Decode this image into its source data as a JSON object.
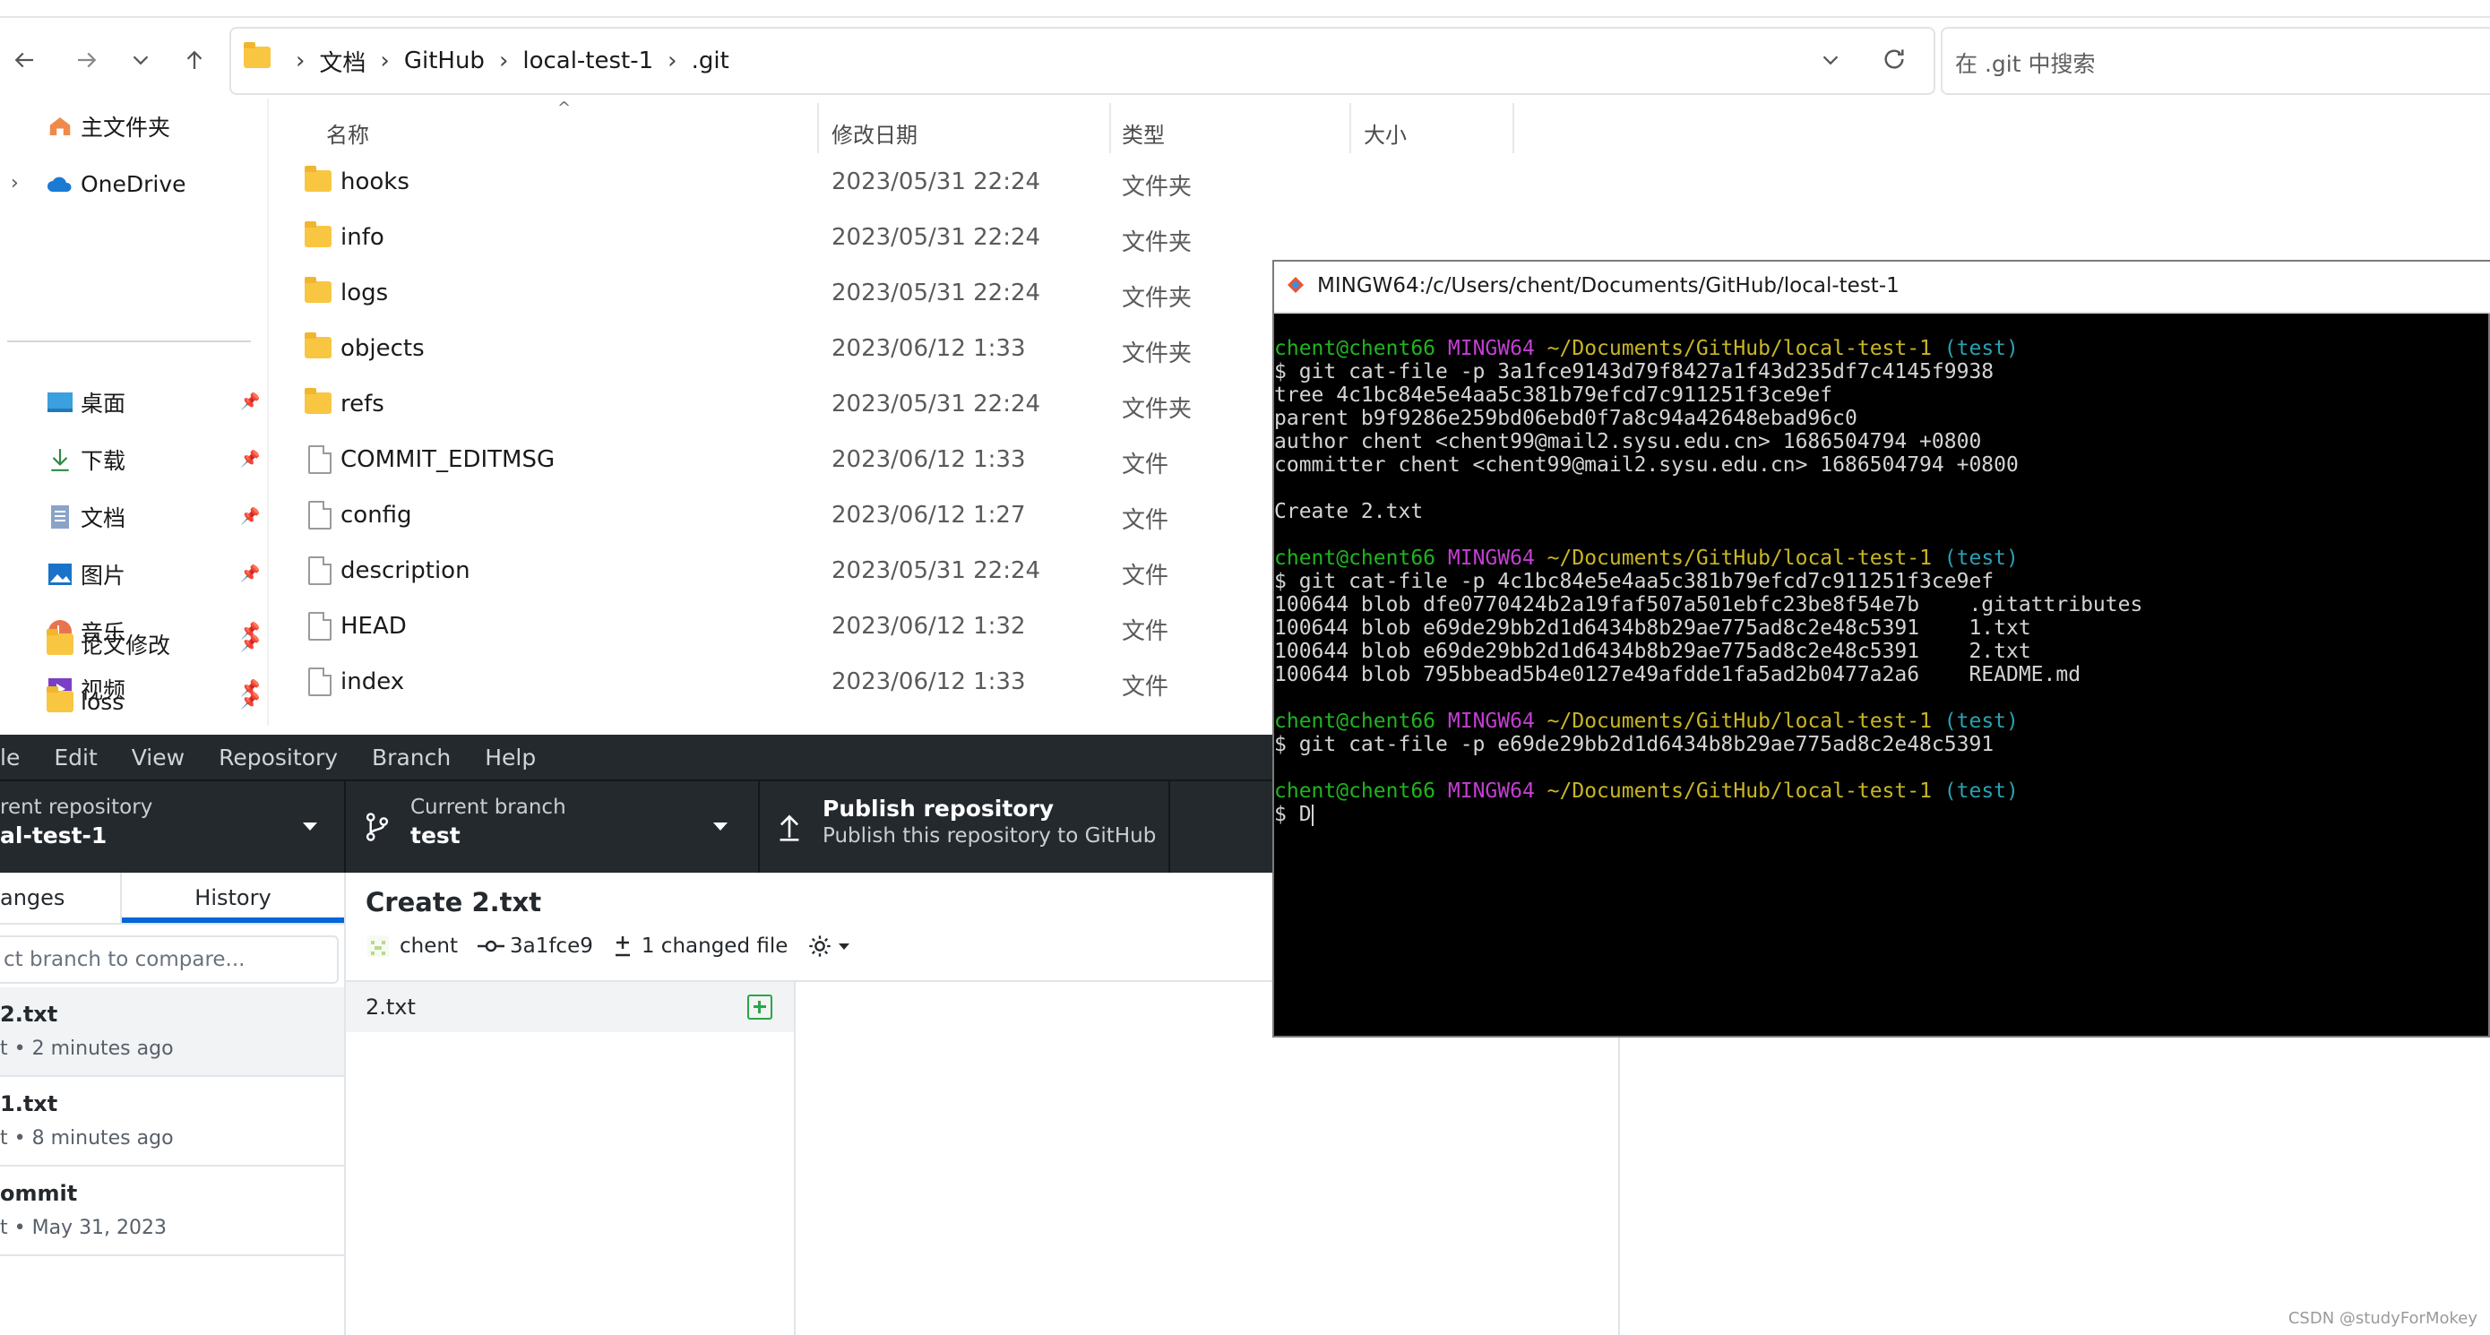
{
  "explorer": {
    "breadcrumb": [
      "文档",
      "GitHub",
      "local-test-1",
      ".git"
    ],
    "search_placeholder": "在 .git 中搜索",
    "sidebar": {
      "top": [
        {
          "label": "主文件夹",
          "icon": "home-icon"
        },
        {
          "label": "OneDrive",
          "icon": "cloud-icon"
        }
      ],
      "pinned": [
        {
          "label": "桌面",
          "icon": "desktop-icon"
        },
        {
          "label": "下载",
          "icon": "download-icon"
        },
        {
          "label": "文档",
          "icon": "document-icon"
        },
        {
          "label": "图片",
          "icon": "picture-icon"
        },
        {
          "label": "音乐",
          "icon": "music-icon"
        },
        {
          "label": "视频",
          "icon": "video-icon"
        },
        {
          "label": "论文修改",
          "icon": "folder-icon"
        },
        {
          "label": "loss",
          "icon": "folder-icon"
        }
      ]
    },
    "columns": {
      "name": "名称",
      "date": "修改日期",
      "type": "类型",
      "size": "大小"
    },
    "files": [
      {
        "name": "hooks",
        "date": "2023/05/31 22:24",
        "type": "文件夹",
        "kind": "folder"
      },
      {
        "name": "info",
        "date": "2023/05/31 22:24",
        "type": "文件夹",
        "kind": "folder"
      },
      {
        "name": "logs",
        "date": "2023/05/31 22:24",
        "type": "文件夹",
        "kind": "folder"
      },
      {
        "name": "objects",
        "date": "2023/06/12 1:33",
        "type": "文件夹",
        "kind": "folder"
      },
      {
        "name": "refs",
        "date": "2023/05/31 22:24",
        "type": "文件夹",
        "kind": "folder"
      },
      {
        "name": "COMMIT_EDITMSG",
        "date": "2023/06/12 1:33",
        "type": "文件",
        "kind": "file"
      },
      {
        "name": "config",
        "date": "2023/06/12 1:27",
        "type": "文件",
        "kind": "file"
      },
      {
        "name": "description",
        "date": "2023/05/31 22:24",
        "type": "文件",
        "kind": "file"
      },
      {
        "name": "HEAD",
        "date": "2023/06/12 1:32",
        "type": "文件",
        "kind": "file"
      },
      {
        "name": "index",
        "date": "2023/06/12 1:33",
        "type": "文件",
        "kind": "file"
      }
    ]
  },
  "github_desktop": {
    "menu": [
      "le",
      "Edit",
      "View",
      "Repository",
      "Branch",
      "Help"
    ],
    "current_repo": {
      "label": "rent repository",
      "value": "al-test-1"
    },
    "current_branch": {
      "label": "Current branch",
      "value": "test"
    },
    "publish": {
      "label": "Publish repository",
      "sub": "Publish this repository to GitHub"
    },
    "tabs": {
      "changes": "anges",
      "history": "History"
    },
    "branch_compare_placeholder": "ct branch to compare...",
    "history": [
      {
        "title": "2.txt",
        "meta": "t • 2 minutes ago"
      },
      {
        "title": "1.txt",
        "meta": "t • 8 minutes ago"
      },
      {
        "title": "ommit",
        "meta": "t • May 31, 2023"
      }
    ],
    "commit": {
      "title": "Create 2.txt",
      "author": "chent",
      "sha": "3a1fce9",
      "changed": "1 changed file",
      "file": "2.txt"
    }
  },
  "terminal": {
    "title": "MINGW64:/c/Users/chent/Documents/GitHub/local-test-1",
    "prompt": {
      "user": "chent@chent66",
      "env": "MINGW64",
      "path": "~/Documents/GitHub/local-test-1",
      "branch": "(test)"
    },
    "commands": [
      "$ git cat-file -p 3a1fce9143d79f8427a1f43d235df7c4145f9938",
      "$ git cat-file -p 4c1bc84e5e4aa5c381b79efcd7c911251f3ce9ef",
      "$ git cat-file -p e69de29bb2d1d6434b8b29ae775ad8c2e48c5391",
      "$ D"
    ],
    "output1": [
      "tree 4c1bc84e5e4aa5c381b79efcd7c911251f3ce9ef",
      "parent b9f9286e259bd06ebd0f7a8c94a42648ebad96c0",
      "author chent <chent99@mail2.sysu.edu.cn> 1686504794 +0800",
      "committer chent <chent99@mail2.sysu.edu.cn> 1686504794 +0800",
      "",
      "Create 2.txt"
    ],
    "output2": [
      "100644 blob dfe0770424b2a19faf507a501ebfc23be8f54e7b    .gitattributes",
      "100644 blob e69de29bb2d1d6434b8b29ae775ad8c2e48c5391    1.txt",
      "100644 blob e69de29bb2d1d6434b8b29ae775ad8c2e48c5391    2.txt",
      "100644 blob 795bbead5b4e0127e49afdde1fa5ad2b0477a2a6    README.md"
    ]
  },
  "watermark": "CSDN @studyForMokey"
}
